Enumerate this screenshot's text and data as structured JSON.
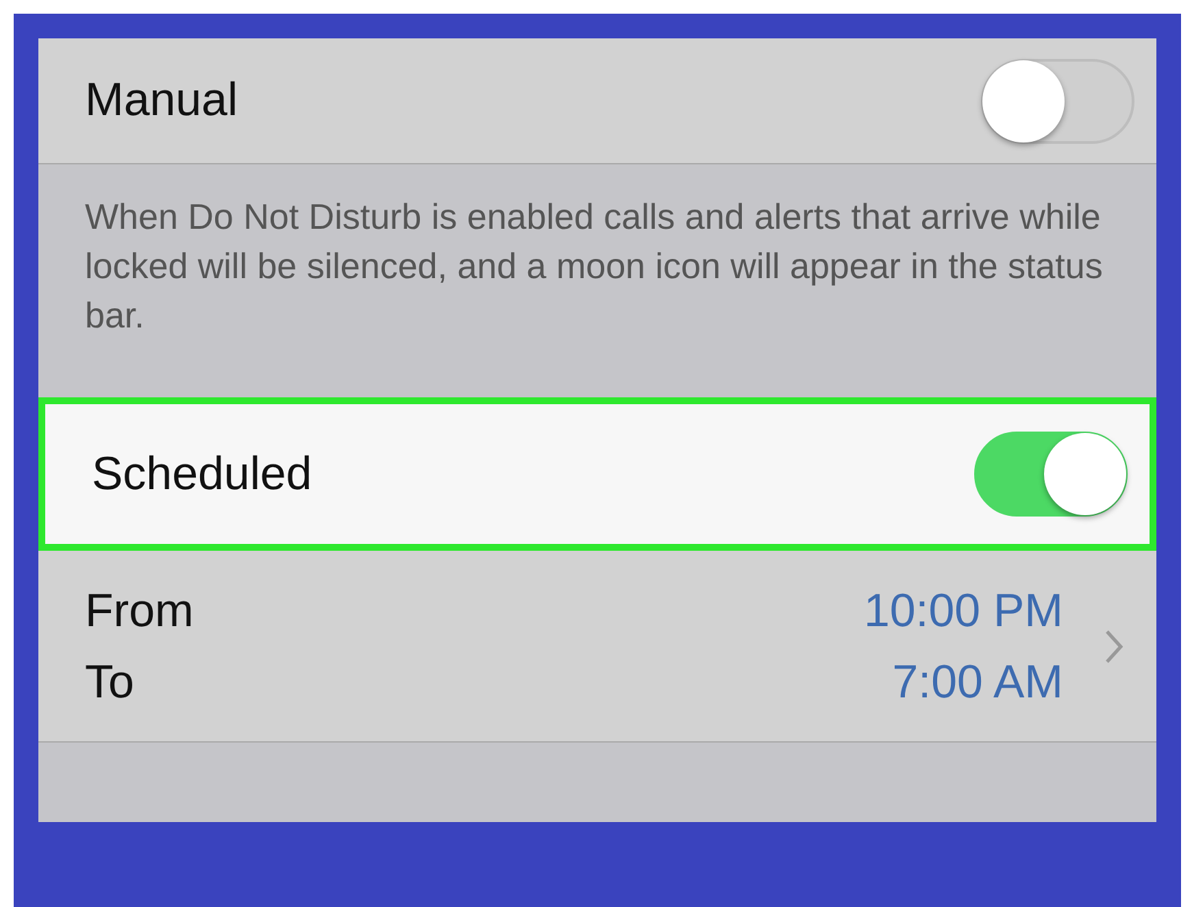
{
  "settings": [
    {
      "kind": "toggle",
      "label": "Manual",
      "on": false,
      "highlighted": false
    },
    {
      "kind": "note",
      "text": "When Do Not Disturb is enabled calls and alerts that arrive while locked will be silenced, and a moon icon will appear in the status bar."
    },
    {
      "kind": "toggle",
      "label": "Scheduled",
      "on": true,
      "highlighted": true
    },
    {
      "kind": "range",
      "labels": [
        "From",
        "To"
      ],
      "values": [
        "10:00 PM",
        "7:00 AM"
      ]
    }
  ]
}
